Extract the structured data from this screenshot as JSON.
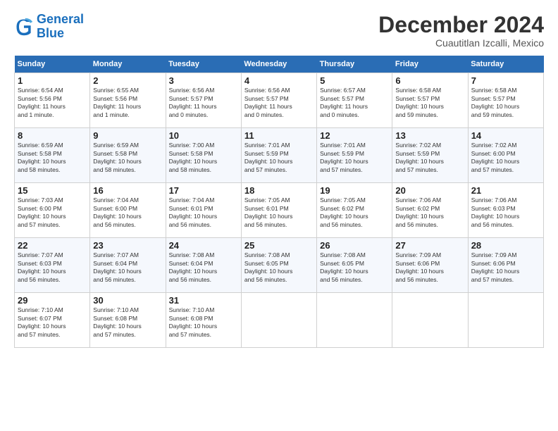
{
  "header": {
    "logo_general": "General",
    "logo_blue": "Blue",
    "title": "December 2024",
    "subtitle": "Cuautitlan Izcalli, Mexico"
  },
  "calendar": {
    "days_of_week": [
      "Sunday",
      "Monday",
      "Tuesday",
      "Wednesday",
      "Thursday",
      "Friday",
      "Saturday"
    ],
    "weeks": [
      [
        {
          "day": "1",
          "info": "Sunrise: 6:54 AM\nSunset: 5:56 PM\nDaylight: 11 hours\nand 1 minute."
        },
        {
          "day": "2",
          "info": "Sunrise: 6:55 AM\nSunset: 5:56 PM\nDaylight: 11 hours\nand 1 minute."
        },
        {
          "day": "3",
          "info": "Sunrise: 6:56 AM\nSunset: 5:57 PM\nDaylight: 11 hours\nand 0 minutes."
        },
        {
          "day": "4",
          "info": "Sunrise: 6:56 AM\nSunset: 5:57 PM\nDaylight: 11 hours\nand 0 minutes."
        },
        {
          "day": "5",
          "info": "Sunrise: 6:57 AM\nSunset: 5:57 PM\nDaylight: 11 hours\nand 0 minutes."
        },
        {
          "day": "6",
          "info": "Sunrise: 6:58 AM\nSunset: 5:57 PM\nDaylight: 10 hours\nand 59 minutes."
        },
        {
          "day": "7",
          "info": "Sunrise: 6:58 AM\nSunset: 5:57 PM\nDaylight: 10 hours\nand 59 minutes."
        }
      ],
      [
        {
          "day": "8",
          "info": "Sunrise: 6:59 AM\nSunset: 5:58 PM\nDaylight: 10 hours\nand 58 minutes."
        },
        {
          "day": "9",
          "info": "Sunrise: 6:59 AM\nSunset: 5:58 PM\nDaylight: 10 hours\nand 58 minutes."
        },
        {
          "day": "10",
          "info": "Sunrise: 7:00 AM\nSunset: 5:58 PM\nDaylight: 10 hours\nand 58 minutes."
        },
        {
          "day": "11",
          "info": "Sunrise: 7:01 AM\nSunset: 5:59 PM\nDaylight: 10 hours\nand 57 minutes."
        },
        {
          "day": "12",
          "info": "Sunrise: 7:01 AM\nSunset: 5:59 PM\nDaylight: 10 hours\nand 57 minutes."
        },
        {
          "day": "13",
          "info": "Sunrise: 7:02 AM\nSunset: 5:59 PM\nDaylight: 10 hours\nand 57 minutes."
        },
        {
          "day": "14",
          "info": "Sunrise: 7:02 AM\nSunset: 6:00 PM\nDaylight: 10 hours\nand 57 minutes."
        }
      ],
      [
        {
          "day": "15",
          "info": "Sunrise: 7:03 AM\nSunset: 6:00 PM\nDaylight: 10 hours\nand 57 minutes."
        },
        {
          "day": "16",
          "info": "Sunrise: 7:04 AM\nSunset: 6:00 PM\nDaylight: 10 hours\nand 56 minutes."
        },
        {
          "day": "17",
          "info": "Sunrise: 7:04 AM\nSunset: 6:01 PM\nDaylight: 10 hours\nand 56 minutes."
        },
        {
          "day": "18",
          "info": "Sunrise: 7:05 AM\nSunset: 6:01 PM\nDaylight: 10 hours\nand 56 minutes."
        },
        {
          "day": "19",
          "info": "Sunrise: 7:05 AM\nSunset: 6:02 PM\nDaylight: 10 hours\nand 56 minutes."
        },
        {
          "day": "20",
          "info": "Sunrise: 7:06 AM\nSunset: 6:02 PM\nDaylight: 10 hours\nand 56 minutes."
        },
        {
          "day": "21",
          "info": "Sunrise: 7:06 AM\nSunset: 6:03 PM\nDaylight: 10 hours\nand 56 minutes."
        }
      ],
      [
        {
          "day": "22",
          "info": "Sunrise: 7:07 AM\nSunset: 6:03 PM\nDaylight: 10 hours\nand 56 minutes."
        },
        {
          "day": "23",
          "info": "Sunrise: 7:07 AM\nSunset: 6:04 PM\nDaylight: 10 hours\nand 56 minutes."
        },
        {
          "day": "24",
          "info": "Sunrise: 7:08 AM\nSunset: 6:04 PM\nDaylight: 10 hours\nand 56 minutes."
        },
        {
          "day": "25",
          "info": "Sunrise: 7:08 AM\nSunset: 6:05 PM\nDaylight: 10 hours\nand 56 minutes."
        },
        {
          "day": "26",
          "info": "Sunrise: 7:08 AM\nSunset: 6:05 PM\nDaylight: 10 hours\nand 56 minutes."
        },
        {
          "day": "27",
          "info": "Sunrise: 7:09 AM\nSunset: 6:06 PM\nDaylight: 10 hours\nand 56 minutes."
        },
        {
          "day": "28",
          "info": "Sunrise: 7:09 AM\nSunset: 6:06 PM\nDaylight: 10 hours\nand 57 minutes."
        }
      ],
      [
        {
          "day": "29",
          "info": "Sunrise: 7:10 AM\nSunset: 6:07 PM\nDaylight: 10 hours\nand 57 minutes."
        },
        {
          "day": "30",
          "info": "Sunrise: 7:10 AM\nSunset: 6:08 PM\nDaylight: 10 hours\nand 57 minutes."
        },
        {
          "day": "31",
          "info": "Sunrise: 7:10 AM\nSunset: 6:08 PM\nDaylight: 10 hours\nand 57 minutes."
        },
        {
          "day": "",
          "info": ""
        },
        {
          "day": "",
          "info": ""
        },
        {
          "day": "",
          "info": ""
        },
        {
          "day": "",
          "info": ""
        }
      ]
    ]
  }
}
